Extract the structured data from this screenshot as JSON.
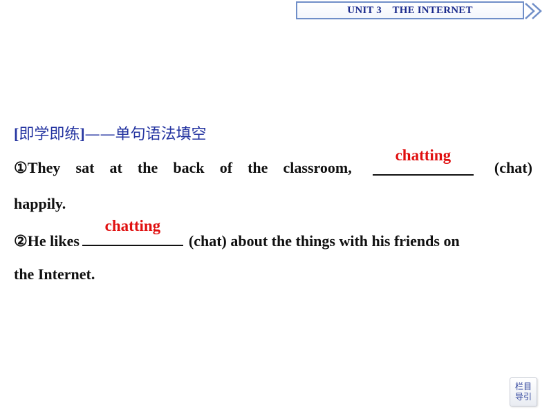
{
  "header": {
    "unit_title": "UNIT 3    THE INTERNET",
    "forward_icon": "double-chevron-right-icon"
  },
  "section": {
    "heading_bracket_open": "[",
    "heading_label": "即学即练",
    "heading_bracket_close": "]",
    "heading_rest": "——单句语法填空"
  },
  "exercises": [
    {
      "number": "①",
      "words_before": [
        "They",
        "sat",
        "at",
        "the",
        "back",
        "of",
        "the",
        "classroom,"
      ],
      "answer": "chatting",
      "hint": "(chat)",
      "continuation": "happily",
      "end": "."
    },
    {
      "number": "②",
      "text_before": "He likes",
      "answer": "chatting",
      "text_after": "(chat) about the things with his friends on",
      "continuation": "the Internet",
      "end": "."
    }
  ],
  "nav": {
    "line1": "栏目",
    "line2": "导引"
  }
}
